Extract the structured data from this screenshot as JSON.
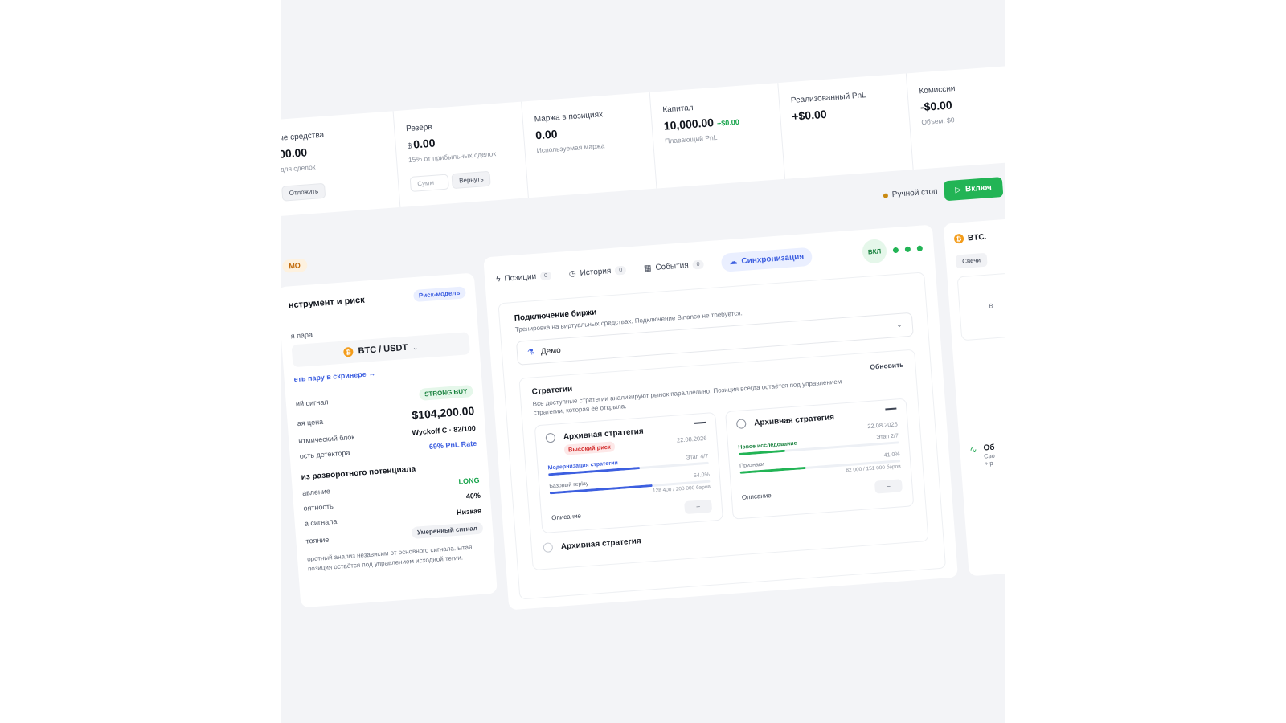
{
  "stats": [
    {
      "label": "ые средства",
      "value": "00.00",
      "sub": "для сделок",
      "button": "Отложить"
    },
    {
      "label": "Резерв",
      "currency": "$",
      "value": "0.00",
      "sub": "15% от прибыльных сделок",
      "input_placeholder": "Сумм",
      "button": "Вернуть"
    },
    {
      "label": "Маржа в позициях",
      "value": "0.00",
      "sub": "Используемая маржа"
    },
    {
      "label": "Капитал",
      "value": "10,000.00",
      "delta": "+$0.00",
      "sub": "Плавающий PnL"
    },
    {
      "label": "Реализованный PnL",
      "value": "+$0.00"
    },
    {
      "label": "Комиссии",
      "value": "-$0.00",
      "sub": "Объем: $0"
    }
  ],
  "controls": {
    "stop_label": "Ручной стоп",
    "enable_button": "Включ"
  },
  "demo_badge": "МО",
  "left_card": {
    "title": "нструмент и риск",
    "badge": "Риск-модель",
    "pair_label": "я пара",
    "pair": "BTC / USDT",
    "link": "еть пару в скринере",
    "rows": [
      {
        "label": "ий сигнал",
        "badge": "STRONG BUY"
      },
      {
        "label": "ая цена",
        "value": "$104,200.00"
      },
      {
        "label": "итмический блок",
        "value": "Wyckoff C · 82/100"
      },
      {
        "label": "ость детектора",
        "value": "69% PnL Rate"
      }
    ],
    "section_title": "из разворотного потенциала",
    "rows2": [
      {
        "label": "авление",
        "value": "LONG"
      },
      {
        "label": "оятность",
        "value": "40%"
      },
      {
        "label": "а сигнала",
        "value": "Низкая"
      },
      {
        "label": "тояние",
        "badge": "Умеренный сигнал"
      }
    ],
    "note": "оротный анализ независим от основного сигнала. ытая позиция остаётся под управлением исходной тегии."
  },
  "tabs": [
    {
      "label": "Позиции",
      "count": "0",
      "icon": "bolt-icon"
    },
    {
      "label": "История",
      "count": "0",
      "icon": "clock-icon"
    },
    {
      "label": "События",
      "count": "0",
      "icon": "calendar-icon"
    },
    {
      "label": "Синхронизация",
      "icon": "cloud-icon"
    }
  ],
  "on_badge": "ВКЛ",
  "exchange": {
    "title": "Подключение биржи",
    "subtitle": "Тренировка на виртуальных средствах. Подключение Binance не требуется.",
    "selected": "Демо"
  },
  "strategies": {
    "title": "Стратегии",
    "refresh": "Обновить",
    "subtitle": "Все доступные стратегии анализируют рынок параллельно. Позиция всегда остаётся под управлением стратегии, которая её открыла.",
    "cards": [
      {
        "name": "Архивная стратегия",
        "date": "22.08.2026",
        "risk": "Высокий риск",
        "p1": {
          "label": "Модернизация стратегии",
          "right": "Этап 4/7",
          "fraction": 0.57,
          "color": "#3d5fe0"
        },
        "p2": {
          "label": "Базовый replay",
          "right": "64.0%",
          "detail": "128 400 / 200 000 баров",
          "fraction": 0.64,
          "color": "#3d5fe0"
        },
        "footer": "Описание"
      },
      {
        "name": "Архивная стратегия",
        "date": "22.08.2026",
        "p1": {
          "label": "Новое исследование",
          "right": "Этап 2/7",
          "fraction": 0.29,
          "color": "#22b455"
        },
        "p2": {
          "label": "Признаки",
          "right": "41.0%",
          "detail": "82 000 / 151 000 баров",
          "fraction": 0.41,
          "color": "#22b455"
        },
        "footer": "Описание"
      }
    ],
    "third_card": "Архивная стратегия"
  },
  "right_panel": {
    "title": "BTC.",
    "tab": "Свечи",
    "box_text": "В",
    "item_title": "Об",
    "item_sub1": "Сво",
    "item_sub2": "+ р"
  }
}
